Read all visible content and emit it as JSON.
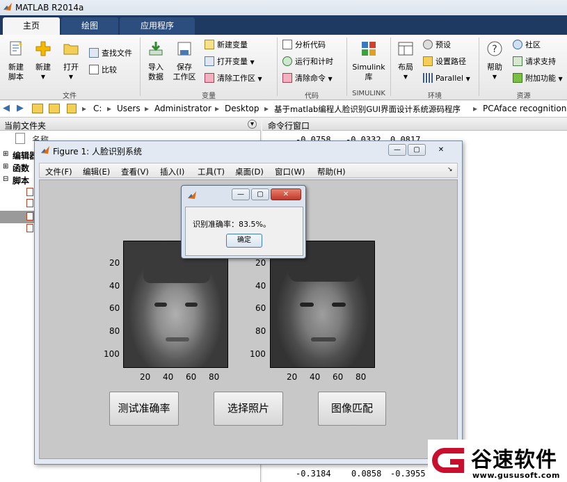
{
  "window": {
    "title": "MATLAB R2014a"
  },
  "tabs": [
    {
      "label": "主页",
      "active": true
    },
    {
      "label": "绘图"
    },
    {
      "label": "应用程序"
    }
  ],
  "ribbon": {
    "file": {
      "new_script": [
        "新建",
        "脚本"
      ],
      "new": "新建",
      "open": "打开",
      "find_files": "查找文件",
      "compare": "比较",
      "group": "文件"
    },
    "variable": {
      "import_data": [
        "导入",
        "数据"
      ],
      "save_workspace": [
        "保存",
        "工作区"
      ],
      "new_variable": "新建变量",
      "open_variable": "打开变量",
      "clear_workspace": "清除工作区",
      "group": "变量"
    },
    "code": {
      "analyze_code": "分析代码",
      "run_and_time": "运行和计时",
      "clear_commands": "清除命令",
      "group": "代码"
    },
    "simulink": {
      "library": [
        "Simulink",
        "库"
      ],
      "group": "SIMULINK"
    },
    "environment": {
      "layout": "布局",
      "preferences": "预设",
      "set_path": "设置路径",
      "parallel": "Parallel",
      "group": "环境"
    },
    "resources": {
      "help": "帮助",
      "community": "社区",
      "request_support": "请求支持",
      "addons": "附加功能",
      "group": "资源"
    }
  },
  "address": {
    "crumbs": [
      "C:",
      "Users",
      "Administrator",
      "Desktop",
      "基于matlab编程人脸识别GUI界面设计系统源码程序",
      "PCAface recognition("
    ]
  },
  "left_pane": {
    "title": "当前文件夹",
    "col_name": "名称",
    "items": [
      "编辑器",
      "函数",
      "脚本"
    ]
  },
  "cmd_pane": {
    "title": "命令行窗口",
    "top_row": [
      "-0.0758",
      "-0.0332",
      "0.0817"
    ],
    "bottom_row": [
      "-0.3184",
      "0.0858",
      "-0.3955"
    ]
  },
  "figure": {
    "title": "Figure 1: 人脸识别系统",
    "menu": [
      "文件(F)",
      "编辑(E)",
      "查看(V)",
      "插入(I)",
      "工具(T)",
      "桌面(D)",
      "窗口(W)",
      "帮助(H)"
    ],
    "y_ticks": [
      "20",
      "40",
      "60",
      "80",
      "100"
    ],
    "x_ticks": [
      "20",
      "40",
      "60",
      "80"
    ],
    "buttons": {
      "test_accuracy": "测试准确率",
      "select_photo": "选择照片",
      "image_match": "图像匹配"
    }
  },
  "dialog": {
    "message": "识别准确率：83.5%。",
    "ok": "确定"
  },
  "watermark": {
    "brand": "谷速软件",
    "url": "www.gususoft.com"
  },
  "colors": {
    "accent": "#1e3a63",
    "watermark_red": "#c8102e"
  }
}
